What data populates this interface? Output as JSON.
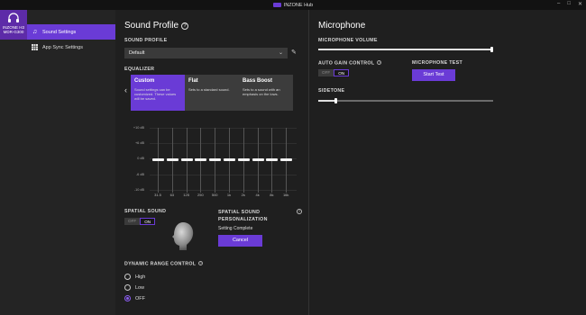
{
  "window": {
    "title": "INZONE Hub",
    "controls": [
      "–",
      "□",
      "✕"
    ]
  },
  "device": {
    "name_line1": "INZONE H3",
    "name_line2": "MDR-G300"
  },
  "sidebar": {
    "items": [
      {
        "label": "Sound Settings",
        "icon": "music-note-icon",
        "active": true
      },
      {
        "label": "App Sync Settings",
        "icon": "grid-icon",
        "active": false
      }
    ]
  },
  "sound_profile": {
    "title": "Sound Profile",
    "profile_label": "SOUND PROFILE",
    "profile_value": "Default",
    "equalizer_label": "EQUALIZER",
    "presets": [
      {
        "title": "Custom",
        "desc": "Sound settings can be customized. These values will be saved.",
        "selected": true
      },
      {
        "title": "Flat",
        "desc": "Sets to a standard sound.",
        "selected": false
      },
      {
        "title": "Bass Boost",
        "desc": "Sets to a sound with an emphasis on the lows.",
        "selected": false
      }
    ],
    "db_labels": [
      "+10 dB",
      "+6 dB",
      "0 dB",
      "-6 dB",
      "-10 dB"
    ],
    "bands": [
      {
        "freq": "31.5",
        "gain_db": 0
      },
      {
        "freq": "63",
        "gain_db": 0
      },
      {
        "freq": "125",
        "gain_db": 0
      },
      {
        "freq": "250",
        "gain_db": 0
      },
      {
        "freq": "500",
        "gain_db": 0
      },
      {
        "freq": "1k",
        "gain_db": 0
      },
      {
        "freq": "2k",
        "gain_db": 0
      },
      {
        "freq": "4k",
        "gain_db": 0
      },
      {
        "freq": "8k",
        "gain_db": 0
      },
      {
        "freq": "16k",
        "gain_db": 0
      }
    ],
    "spatial_sound_label": "SPATIAL SOUND",
    "spatial_toggle": {
      "off": "OFF",
      "on": "ON",
      "state": "ON"
    },
    "personalization_label_1": "SPATIAL SOUND",
    "personalization_label_2": "PERSONALIZATION",
    "personalization_status": "Setting Complete",
    "cancel_label": "Cancel",
    "drc_label": "DYNAMIC RANGE CONTROL",
    "drc_options": [
      {
        "label": "High",
        "selected": false
      },
      {
        "label": "Low",
        "selected": false
      },
      {
        "label": "OFF",
        "selected": true
      }
    ]
  },
  "microphone": {
    "title": "Microphone",
    "volume_label": "MICROPHONE VOLUME",
    "volume_level": 1.0,
    "agc_label": "AUTO GAIN CONTROL",
    "agc_toggle": {
      "off": "OFF",
      "on": "ON",
      "state": "ON"
    },
    "test_label": "MICROPHONE TEST",
    "start_test_label": "Start Test",
    "sidetone_label": "SIDETONE",
    "sidetone_level": 0.1
  },
  "colors": {
    "accent": "#6a3bd6",
    "background": "#1f1f1f",
    "sidebar": "#242424"
  }
}
